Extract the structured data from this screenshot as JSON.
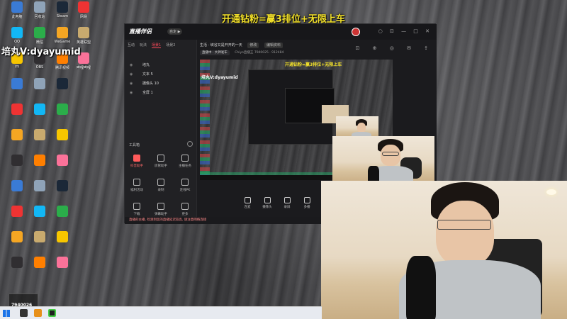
{
  "overlay": {
    "top_banner": "开通钻粉=赢3排位+无限上车",
    "left_banner": "培丸V:dyayumid",
    "room_number": "7940026"
  },
  "desktop": {
    "icons": [
      {
        "label": "此电脑",
        "color": "#3a7bd5"
      },
      {
        "label": "回收站",
        "color": "#8fa3b8"
      },
      {
        "label": "Steam",
        "color": "#1b2838"
      },
      {
        "label": "网易",
        "color": "#e33"
      },
      {
        "label": "QQ",
        "color": "#12b7f5"
      },
      {
        "label": "微信",
        "color": "#2bad4a"
      },
      {
        "label": "WeGame",
        "color": "#f5a623"
      },
      {
        "label": "英雄联盟",
        "color": "#c8aa6e"
      },
      {
        "label": "YY",
        "color": "#f7c600"
      },
      {
        "label": "OBS",
        "color": "#302e31"
      },
      {
        "label": "腾讯视频",
        "color": "#ff7f00"
      },
      {
        "label": "哔哩哔哩",
        "color": "#fb7299"
      }
    ]
  },
  "app": {
    "logo": "直播伴侣",
    "version_badge": "自定 ▶",
    "window_controls": "○ ⊡ — □ ✕",
    "tabs": [
      {
        "label": "互动",
        "active": false
      },
      {
        "label": "玩法",
        "active": false
      },
      {
        "label": "场景1",
        "active": true
      },
      {
        "label": "场景2",
        "active": false
      }
    ],
    "scenes": [
      {
        "label": "培丸"
      },
      {
        "label": "文本 5"
      },
      {
        "label": "摄像头 10"
      },
      {
        "label": "全屏 1"
      }
    ],
    "tools_title": "工具箱",
    "tools": [
      {
        "label": "抖音助手",
        "hot": true
      },
      {
        "label": "房管助手",
        "hot": false
      },
      {
        "label": "主播任务",
        "hot": false
      },
      {
        "label": "福利活动",
        "hot": false
      },
      {
        "label": "录制",
        "hot": false
      },
      {
        "label": "连线PK",
        "hot": false
      },
      {
        "label": "下载",
        "hot": false
      },
      {
        "label": "弹幕助手",
        "hot": false
      },
      {
        "label": "更多",
        "hot": false
      }
    ],
    "live_title": "生活 · 峡谷又是开开的一天",
    "live_tag": "修改",
    "status_badge": "直播中 · 大神发车",
    "status_counts": "Chiyo直播王 7940025  · 912484",
    "edit_label": "编辑资料",
    "right_icons": "⊡ ⊕ ◎ ✉ ⇪",
    "bottom_tools": [
      {
        "label": "连麦"
      },
      {
        "label": "摄像头"
      },
      {
        "label": "录屏"
      },
      {
        "label": "多播"
      }
    ],
    "notice": "直播的主播, 检测到您的直播延迟较高, 请注意网络连接"
  },
  "preview": {
    "banner": "开通钻粉=赢3排位+无限上车",
    "left": "培丸V:dyayumid"
  }
}
